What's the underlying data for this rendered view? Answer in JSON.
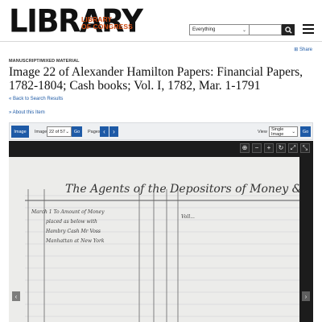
{
  "header": {
    "logo_main": "LIBRARY",
    "logo_sub_line1": "LIBRARY",
    "logo_sub_line2": "OF CONGRESS",
    "search_scope": "Everything",
    "search_value": ""
  },
  "share_label": "Share",
  "item": {
    "format": "MANUSCRIPT/MIXED MATERIAL",
    "title": "Image 22 of Alexander Hamilton Papers: Financial Papers, 1782-1804; Cash books; Vol. I, 1782, Mar. 1-1791",
    "back_link": "« Back to Search Results",
    "about_link": "» About this Item"
  },
  "toolbar": {
    "image_tab": "Image",
    "image_label": "Image",
    "image_value": "22 of 57",
    "go_label": "Go",
    "pages_label": "Pages",
    "view_label": "View",
    "view_value": "Single Image",
    "go2_label": "Go"
  },
  "viewer": {
    "controls": [
      "target-icon",
      "zoom-out-icon",
      "zoom-in-icon",
      "rotate-icon",
      "expand-icon",
      "fullscreen-icon"
    ],
    "handwriting_header": "The Agents of the Depositors of Money &c",
    "handwriting_line1": "March 1  To Amount of Money",
    "handwriting_line2": "placed as below with",
    "handwriting_line3": "Hambry  Cash  Mr Voss",
    "handwriting_line4": "Manhattan at New York",
    "handwriting_amount": "Voll..."
  },
  "colors": {
    "brand_orange": "#d24c13",
    "link_blue": "#1e5aa6",
    "toolbar_bg": "#eef0f2",
    "viewer_bg": "#1c1c1c"
  }
}
